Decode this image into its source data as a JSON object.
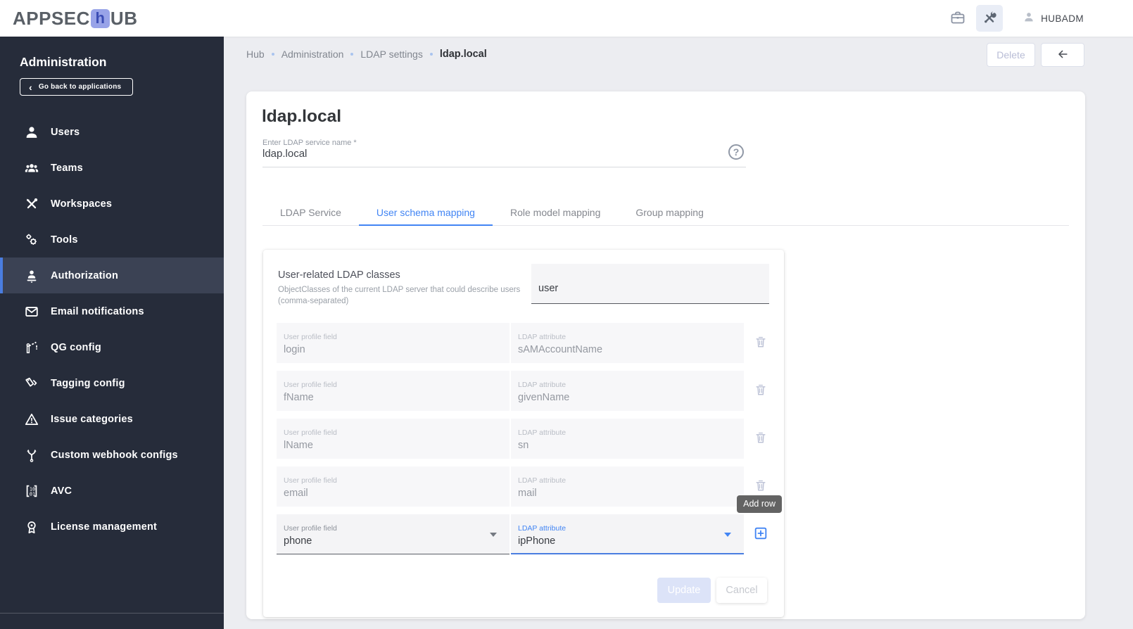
{
  "topbar": {
    "logo_prefix": "APPSEC",
    "logo_letter": "h",
    "logo_suffix": "UB",
    "username": "HUBADM",
    "icons": [
      "briefcase-icon",
      "tools-icon",
      "person-icon"
    ]
  },
  "breadcrumb": {
    "items": [
      "Hub",
      "Administration",
      "LDAP settings"
    ],
    "current": "ldap.local"
  },
  "page_actions": {
    "delete_label": "Delete",
    "back_icon": "arrow-left-icon"
  },
  "sidebar": {
    "title": "Administration",
    "back_label": "Go back to applications",
    "items": [
      {
        "label": "Users",
        "icon": "users-icon",
        "active": false
      },
      {
        "label": "Teams",
        "icon": "teams-icon",
        "active": false
      },
      {
        "label": "Workspaces",
        "icon": "workspaces-icon",
        "active": false
      },
      {
        "label": "Tools",
        "icon": "tools-icon",
        "active": false
      },
      {
        "label": "Authorization",
        "icon": "authorization-icon",
        "active": true
      },
      {
        "label": "Email notifications",
        "icon": "email-icon",
        "active": false
      },
      {
        "label": "QG config",
        "icon": "qg-config-icon",
        "active": false
      },
      {
        "label": "Tagging config",
        "icon": "tagging-icon",
        "active": false
      },
      {
        "label": "Issue categories",
        "icon": "issue-categories-icon",
        "active": false
      },
      {
        "label": "Custom webhook configs",
        "icon": "webhook-icon",
        "active": false
      },
      {
        "label": "AVC",
        "icon": "avc-icon",
        "active": false
      },
      {
        "label": "License management",
        "icon": "license-icon",
        "active": false
      }
    ]
  },
  "main": {
    "title": "ldap.local",
    "service_name": {
      "label": "Enter LDAP service name *",
      "value": "ldap.local"
    },
    "tabs": [
      {
        "label": "LDAP Service",
        "active": false
      },
      {
        "label": "User schema mapping",
        "active": true
      },
      {
        "label": "Role model mapping",
        "active": false
      },
      {
        "label": "Group mapping",
        "active": false
      }
    ],
    "classes": {
      "label": "User-related LDAP classes",
      "description": "ObjectClasses of the current LDAP server that could describe users (comma-separated)",
      "value": "user"
    },
    "mapping": {
      "field_label": "User profile field",
      "attr_label": "LDAP attribute",
      "rows": [
        {
          "field": "login",
          "attr": "sAMAccountName"
        },
        {
          "field": "fName",
          "attr": "givenName"
        },
        {
          "field": "lName",
          "attr": "sn"
        },
        {
          "field": "email",
          "attr": "mail"
        }
      ],
      "editable_row": {
        "field": "phone",
        "attr": "ipPhone"
      }
    },
    "tooltip": "Add row",
    "buttons": {
      "update": "Update",
      "cancel": "Cancel"
    }
  },
  "colors": {
    "accent": "#4285f4",
    "sidebar_bg": "#262c3a",
    "sidebar_active_bg": "#3b4254",
    "sidebar_active_bar": "#4a7de0",
    "page_bg": "#ecedf1",
    "tooltip_bg": "#636363",
    "update_disabled_bg": "#dce3f8",
    "logo_square": "#98a3e8"
  }
}
